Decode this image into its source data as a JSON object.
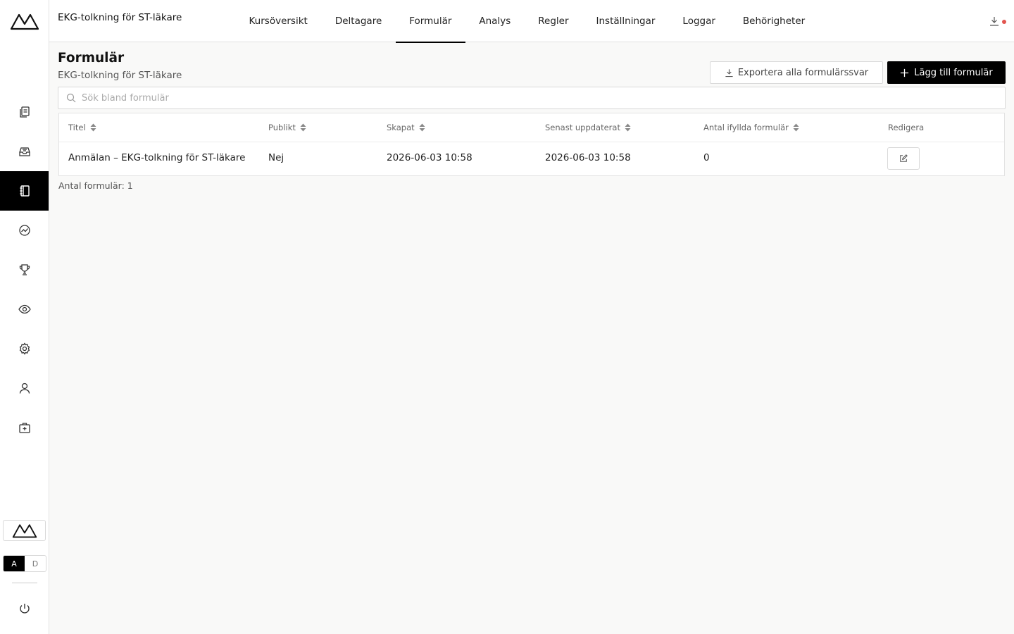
{
  "header": {
    "course_title": "EKG-tolkning för ST-läkare",
    "tabs": [
      {
        "label": "Kursöversikt",
        "active": false
      },
      {
        "label": "Deltagare",
        "active": false
      },
      {
        "label": "Formulär",
        "active": true
      },
      {
        "label": "Analys",
        "active": false
      },
      {
        "label": "Regler",
        "active": false
      },
      {
        "label": "Inställningar",
        "active": false
      },
      {
        "label": "Loggar",
        "active": false
      },
      {
        "label": "Behörigheter",
        "active": false
      }
    ],
    "download_icon": "download-icon",
    "notification_color": "#e2554f"
  },
  "sidebar": {
    "items": [
      {
        "icon": "copy-icon",
        "active": false
      },
      {
        "icon": "inbox-icon",
        "active": false
      },
      {
        "icon": "notebook-icon",
        "active": true
      },
      {
        "icon": "analytics-icon",
        "active": false
      },
      {
        "icon": "trophy-icon",
        "active": false
      },
      {
        "icon": "eye-icon",
        "active": false
      },
      {
        "icon": "gear-icon",
        "active": false
      },
      {
        "icon": "user-icon",
        "active": false
      },
      {
        "icon": "medical-kit-icon",
        "active": false
      }
    ],
    "mode_toggle": {
      "a": "A",
      "d": "D",
      "selected": "A"
    }
  },
  "main": {
    "title": "Formulär",
    "subtitle": "EKG-tolkning för ST-läkare",
    "export_label": "Exportera alla formulärssvar",
    "add_label": "Lägg till formulär",
    "search_placeholder": "Sök bland formulär",
    "table": {
      "columns": {
        "title": "Titel",
        "public": "Publikt",
        "created": "Skapat",
        "updated": "Senast uppdaterat",
        "filled": "Antal ifyllda formulär",
        "edit": "Redigera"
      },
      "rows": [
        {
          "title": "Anmälan – EKG-tolkning för ST-läkare",
          "public": "Nej",
          "created": "2026-06-03 10:58",
          "updated": "2026-06-03 10:58",
          "filled": "0"
        }
      ]
    },
    "count_text": "Antal formulär: 1"
  }
}
